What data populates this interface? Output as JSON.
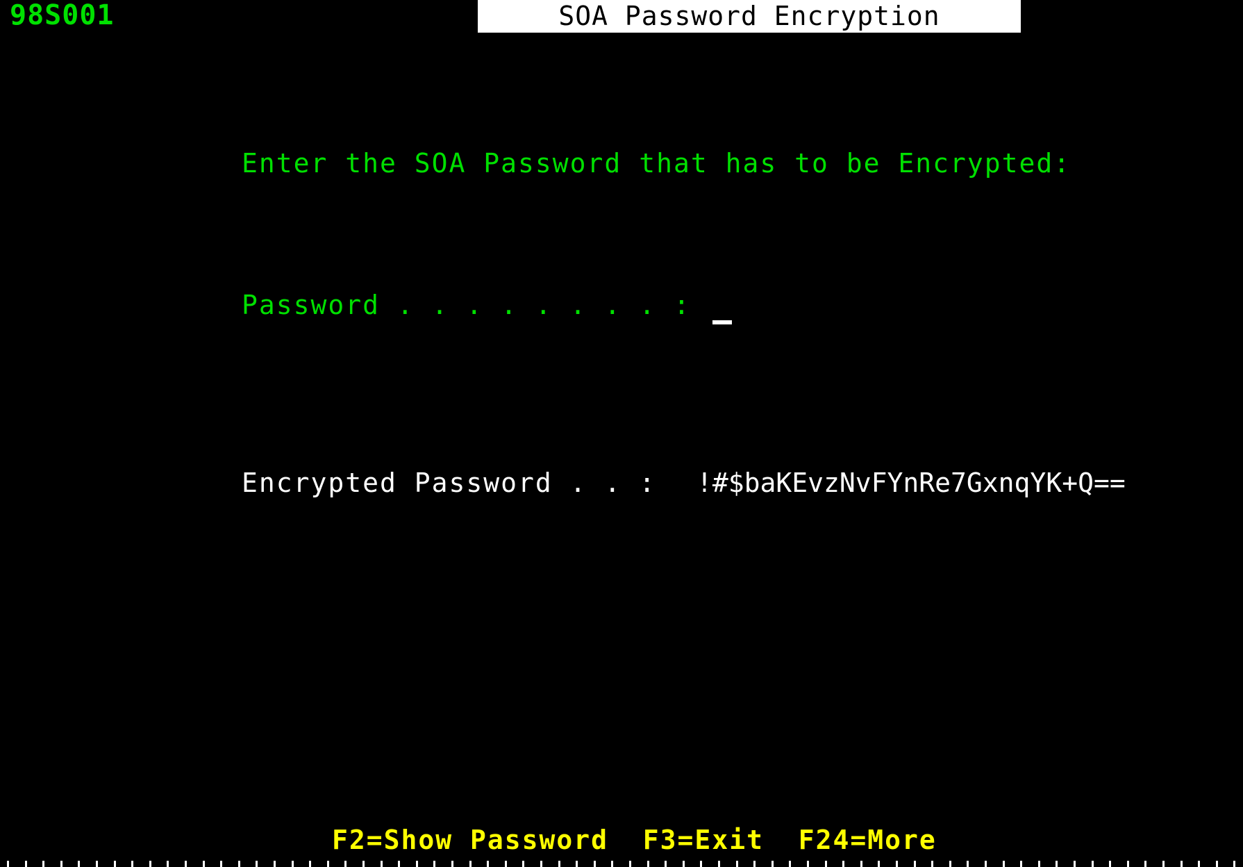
{
  "screen": {
    "id_label": "98S001",
    "title": "SOA Password Encryption",
    "background_color": "#000000",
    "green_color": "#00e000",
    "white_color": "#ffffff",
    "yellow_color": "#ffff00",
    "columns": 70,
    "tick_spacing_px": 25.6
  },
  "body": {
    "instruction": "Enter the SOA Password that has to be Encrypted:",
    "password_label": "Password . . . . . . . . :",
    "password_value": "",
    "password_placeholder": "",
    "cursor": "_",
    "encrypted_label": "Encrypted Password . . :",
    "encrypted_value": "!#$baKEvzNvFYnRe7GxnqYK+Q=="
  },
  "function_keys": {
    "line": "F2=Show Password  F3=Exit  F24=More",
    "items": [
      {
        "key": "F2",
        "label": "F2=Show Password"
      },
      {
        "key": "F3",
        "label": "F3=Exit"
      },
      {
        "key": "F24",
        "label": "F24=More"
      }
    ]
  }
}
